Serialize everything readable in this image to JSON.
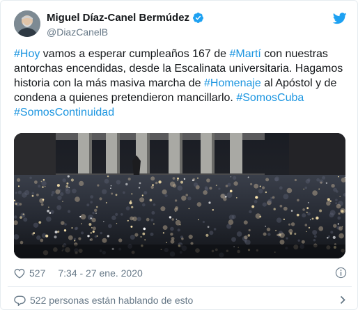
{
  "author": {
    "display_name": "Miguel Díaz-Canel Bermúdez",
    "handle": "@DiazCanelB",
    "verified": true,
    "avatar_icon": "avatar-portrait"
  },
  "tweet": {
    "segments": [
      {
        "text": "#Hoy",
        "type": "hashtag"
      },
      {
        "text": " vamos a esperar cumpleaños 167 de ",
        "type": "text"
      },
      {
        "text": "#Martí",
        "type": "hashtag"
      },
      {
        "text": " con nuestras antorchas encendidas, desde la Escalinata universitaria. Hagamos historia con la más masiva marcha de ",
        "type": "text"
      },
      {
        "text": "#Homenaje",
        "type": "hashtag"
      },
      {
        "text": " al Apóstol y de condena a quienes pretendieron mancillarlo. ",
        "type": "text"
      },
      {
        "text": "#SomosCuba",
        "type": "hashtag"
      },
      {
        "text": " ",
        "type": "text"
      },
      {
        "text": "#SomosContinuidad",
        "type": "hashtag"
      }
    ]
  },
  "footer": {
    "like_count": "527",
    "timestamp": "7:34 - 27 ene. 2020",
    "conversation_text": "522 personas están hablando de esto"
  },
  "colors": {
    "link": "#1b95e0",
    "verified": "#1da1f2",
    "bird": "#1da1f2",
    "meta": "#657786"
  },
  "icons": {
    "brand": "twitter-bird-icon",
    "verified": "verified-badge-icon",
    "like": "heart-icon",
    "info": "info-icon",
    "conversation": "comment-icon",
    "chevron": "chevron-right-icon"
  }
}
